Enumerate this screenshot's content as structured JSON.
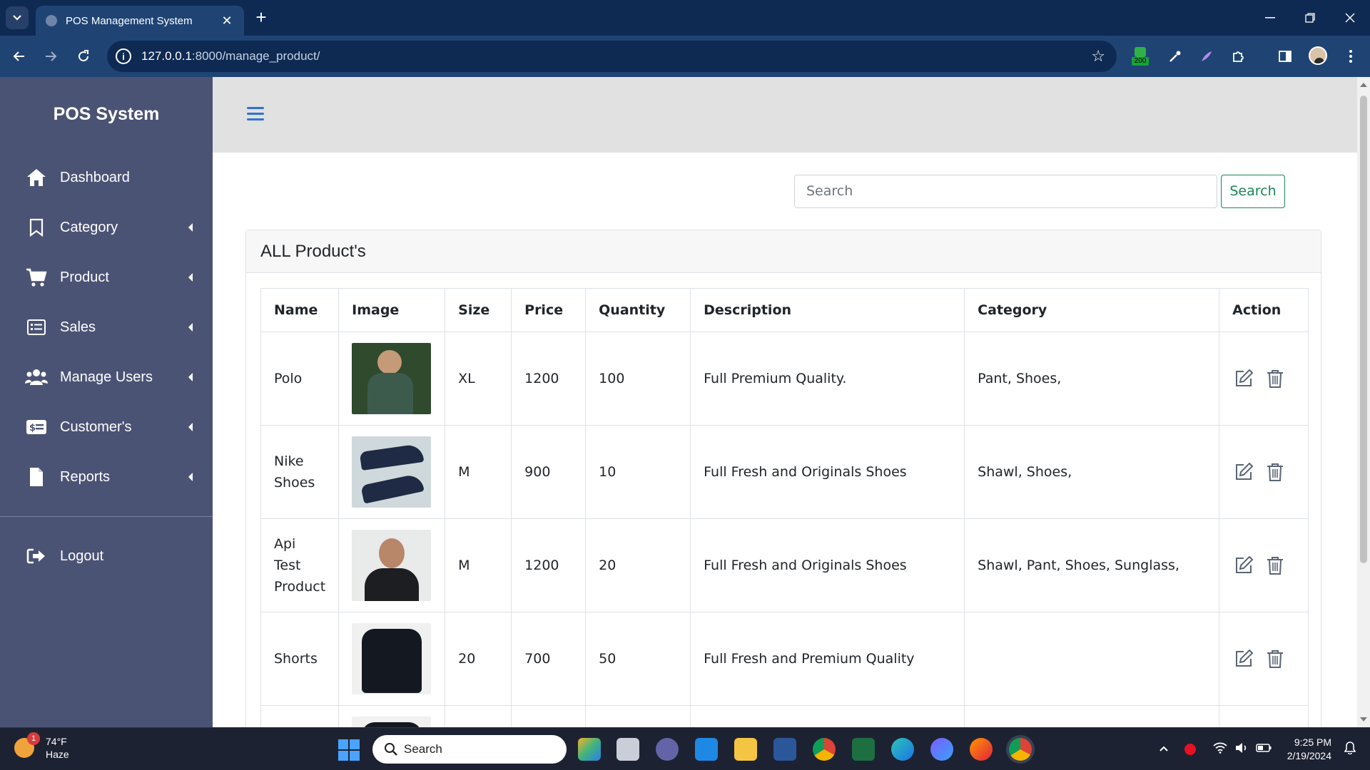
{
  "browser": {
    "tab_title": "POS Management System",
    "url_host": "127.0.0.1",
    "url_path": ":8000/manage_product/",
    "extension_badge": "200"
  },
  "sidebar": {
    "brand": "POS System",
    "items": [
      {
        "label": "Dashboard",
        "icon": "home-icon",
        "has_submenu": false
      },
      {
        "label": "Category",
        "icon": "bookmark-icon",
        "has_submenu": true
      },
      {
        "label": "Product",
        "icon": "cart-icon",
        "has_submenu": true
      },
      {
        "label": "Sales",
        "icon": "list-icon",
        "has_submenu": true
      },
      {
        "label": "Manage Users",
        "icon": "users-icon",
        "has_submenu": true
      },
      {
        "label": "Customer's",
        "icon": "money-card-icon",
        "has_submenu": true
      },
      {
        "label": "Reports",
        "icon": "file-icon",
        "has_submenu": true
      }
    ],
    "logout": "Logout"
  },
  "search": {
    "placeholder": "Search",
    "button": "Search"
  },
  "card": {
    "title": "ALL Product's"
  },
  "table": {
    "headers": [
      "Name",
      "Image",
      "Size",
      "Price",
      "Quantity",
      "Description",
      "Category",
      "Action"
    ],
    "rows": [
      {
        "name": "Polo",
        "size": "XL",
        "price": "1200",
        "quantity": "100",
        "description": "Full Premium Quality.",
        "category": "Pant, Shoes,"
      },
      {
        "name": "Nike Shoes",
        "size": "M",
        "price": "900",
        "quantity": "10",
        "description": "Full Fresh and Originals Shoes",
        "category": "Shawl, Shoes,"
      },
      {
        "name": "Api Test Product",
        "size": "M",
        "price": "1200",
        "quantity": "20",
        "description": "Full Fresh and Originals Shoes",
        "category": "Shawl, Pant, Shoes, Sunglass,"
      },
      {
        "name": "Shorts",
        "size": "20",
        "price": "700",
        "quantity": "50",
        "description": "Full Fresh and Premium Quality",
        "category": ""
      }
    ]
  },
  "taskbar": {
    "weather_temp": "74°F",
    "weather_desc": "Haze",
    "weather_badge": "1",
    "search_label": "Search",
    "time": "9:25 PM",
    "date": "2/19/2024"
  },
  "colors": {
    "sidebar_bg": "#4b5375",
    "topbar_bg": "#e1e1e1",
    "accent_blue": "#2f72d6",
    "search_green": "#198754",
    "chrome_dark": "#0f2a52",
    "chrome_toolbar": "#1f4474"
  }
}
